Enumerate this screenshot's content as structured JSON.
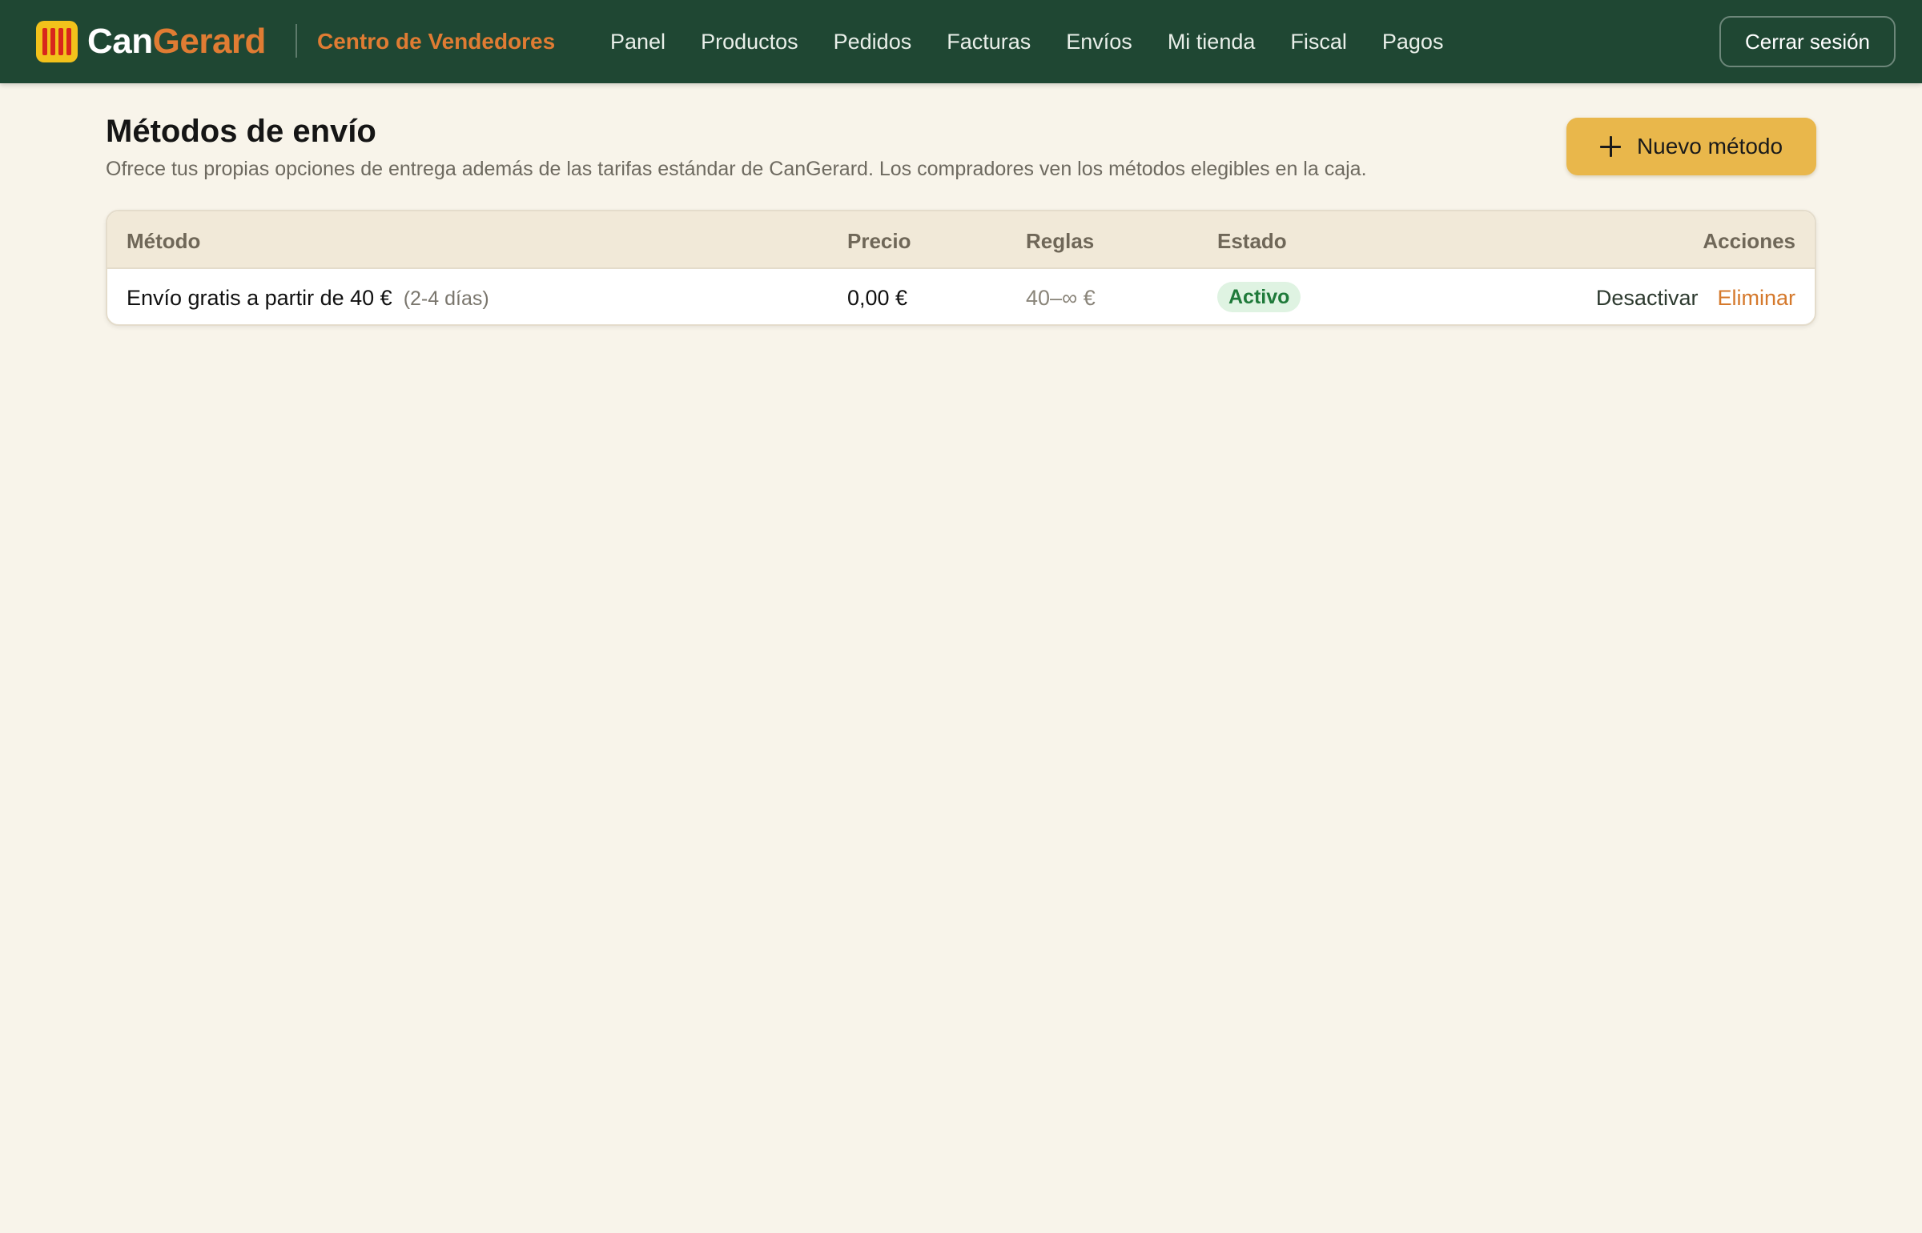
{
  "header": {
    "brand_part1": "Can",
    "brand_part2": "Gerard",
    "center_title": "Centro de Vendedores",
    "nav": [
      "Panel",
      "Productos",
      "Pedidos",
      "Facturas",
      "Envíos",
      "Mi tienda",
      "Fiscal",
      "Pagos"
    ],
    "logout_label": "Cerrar sesión"
  },
  "page": {
    "title": "Métodos de envío",
    "subtitle": "Ofrece tus propias opciones de entrega además de las tarifas estándar de CanGerard. Los compradores ven los métodos elegibles en la caja.",
    "new_button_label": "Nuevo método"
  },
  "table": {
    "columns": {
      "method": "Método",
      "price": "Precio",
      "rules": "Reglas",
      "status": "Estado",
      "actions": "Acciones"
    },
    "rows": [
      {
        "method": "Envío gratis a partir de 40 €",
        "days": "(2-4 días)",
        "price": "0,00 €",
        "rules": "40–∞ €",
        "status": "Activo",
        "action_toggle": "Desactivar",
        "action_delete": "Eliminar"
      }
    ]
  },
  "colors": {
    "header_bg": "#1f4733",
    "brand_accent": "#e07c33",
    "button_bg": "#e9b74b",
    "status_active_bg": "#dff3e2",
    "status_active_text": "#1f7a3a",
    "page_bg": "#f8f4ea"
  },
  "icons": {
    "logo": "stripes-logo-icon",
    "new_button": "plus-icon"
  }
}
